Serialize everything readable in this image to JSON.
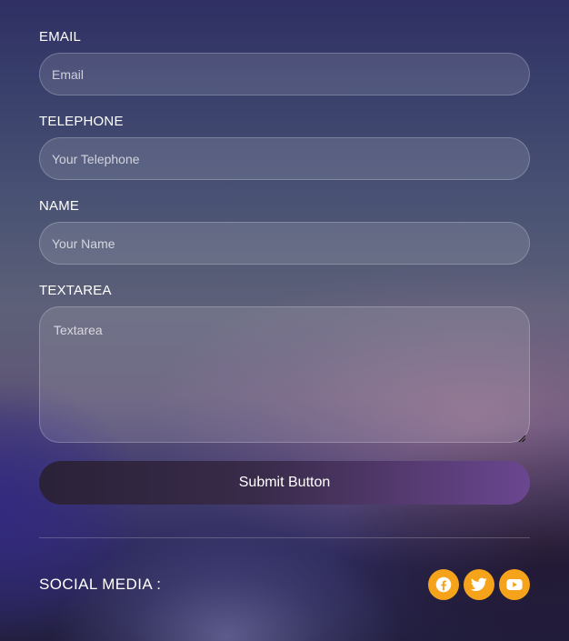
{
  "form": {
    "email": {
      "label": "EMAIL",
      "placeholder": "Email",
      "value": ""
    },
    "telephone": {
      "label": "TELEPHONE",
      "placeholder": "Your Telephone",
      "value": ""
    },
    "name": {
      "label": "NAME",
      "placeholder": "Your Name",
      "value": ""
    },
    "textarea": {
      "label": "TEXTAREA",
      "placeholder": "Textarea",
      "value": ""
    },
    "submit_label": "Submit Button"
  },
  "social": {
    "label": "SOCIAL MEDIA :",
    "icons": [
      "facebook-icon",
      "twitter-icon",
      "youtube-icon"
    ]
  },
  "colors": {
    "accent": "#f5a31b",
    "button_gradient_start": "#2a2238",
    "button_gradient_end": "#6a4690"
  }
}
